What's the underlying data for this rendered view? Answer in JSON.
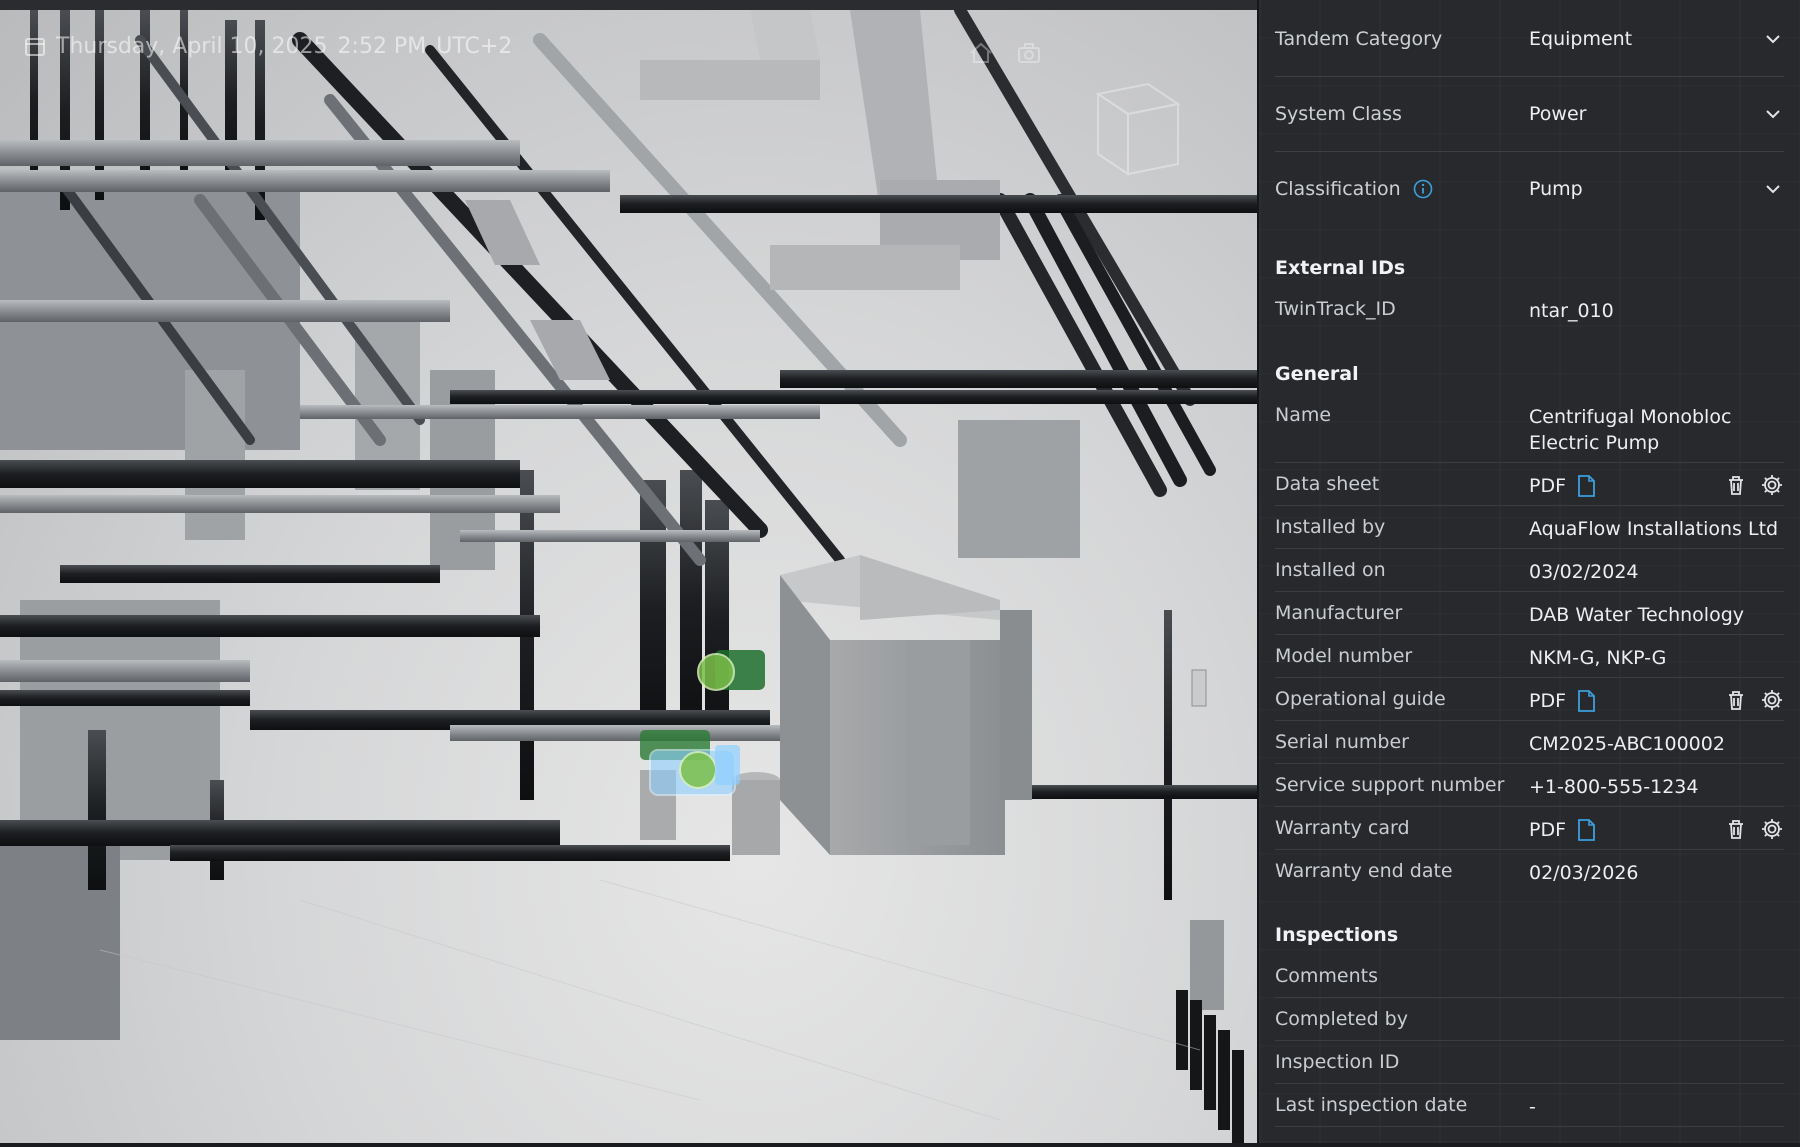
{
  "viewport": {
    "date_label": "Thursday, April 10, 2025",
    "time_label": "2:52 PM",
    "tz_label": "UTC+2"
  },
  "properties": {
    "dropdowns": [
      {
        "label": "Tandem Category",
        "value": "Equipment"
      },
      {
        "label": "System Class",
        "value": "Power"
      },
      {
        "label": "Classification",
        "value": "Pump"
      }
    ],
    "external_ids": {
      "title": "External IDs",
      "rows": [
        {
          "label": "TwinTrack_ID",
          "value": "ntar_010"
        }
      ]
    },
    "general": {
      "title": "General",
      "name_label": "Name",
      "name_value_line1": "Centrifugal Monobloc",
      "name_value_line2": "Electric Pump",
      "data_sheet_label": "Data sheet",
      "installed_by_label": "Installed by",
      "installed_by_value": "AquaFlow Installations Ltd",
      "installed_on_label": "Installed on",
      "installed_on_value": "03/02/2024",
      "manufacturer_label": "Manufacturer",
      "manufacturer_value": "DAB Water Technology",
      "model_label": "Model number",
      "model_value": "NKM-G, NKP-G",
      "op_guide_label": "Operational guide",
      "serial_label": "Serial number",
      "serial_value": "CM2025-ABC100002",
      "support_label": "Service support number",
      "support_value": "+1-800-555-1234",
      "warranty_card_label": "Warranty card",
      "warranty_end_label": "Warranty end date",
      "warranty_end_value": "02/03/2026",
      "pdf_label": "PDF"
    },
    "inspections": {
      "title": "Inspections",
      "comments_label": "Comments",
      "completed_by_label": "Completed by",
      "inspection_id_label": "Inspection ID",
      "last_inspection_label": "Last inspection date",
      "last_inspection_value": "-"
    }
  },
  "colors": {
    "panel_bg": "#27292c",
    "link_blue": "#3aa0dd",
    "selection_green": "#7cc04a",
    "selection_blue": "#8fd0ff"
  }
}
